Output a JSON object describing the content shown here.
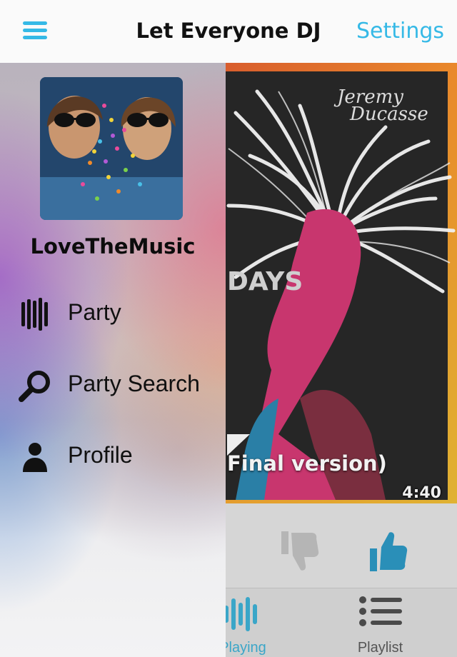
{
  "nav": {
    "title": "Let Everyone DJ",
    "settings_label": "Settings",
    "accent_color": "#35b9e6"
  },
  "drawer": {
    "username": "LoveTheMusic",
    "items": [
      {
        "label": "Party",
        "icon": "equalizer-bars-icon"
      },
      {
        "label": "Party Search",
        "icon": "magnifier-icon"
      },
      {
        "label": "Profile",
        "icon": "person-icon"
      }
    ]
  },
  "now_playing": {
    "album_text": "DAYS",
    "album_artist_logo": "Jeremy Ducasse",
    "track_title": "Final version)",
    "duration": "4:40"
  },
  "tabs": [
    {
      "label": "Playing",
      "icon": "equalizer-bars-icon",
      "active": true
    },
    {
      "label": "Playlist",
      "icon": "list-icon",
      "active": false
    }
  ]
}
